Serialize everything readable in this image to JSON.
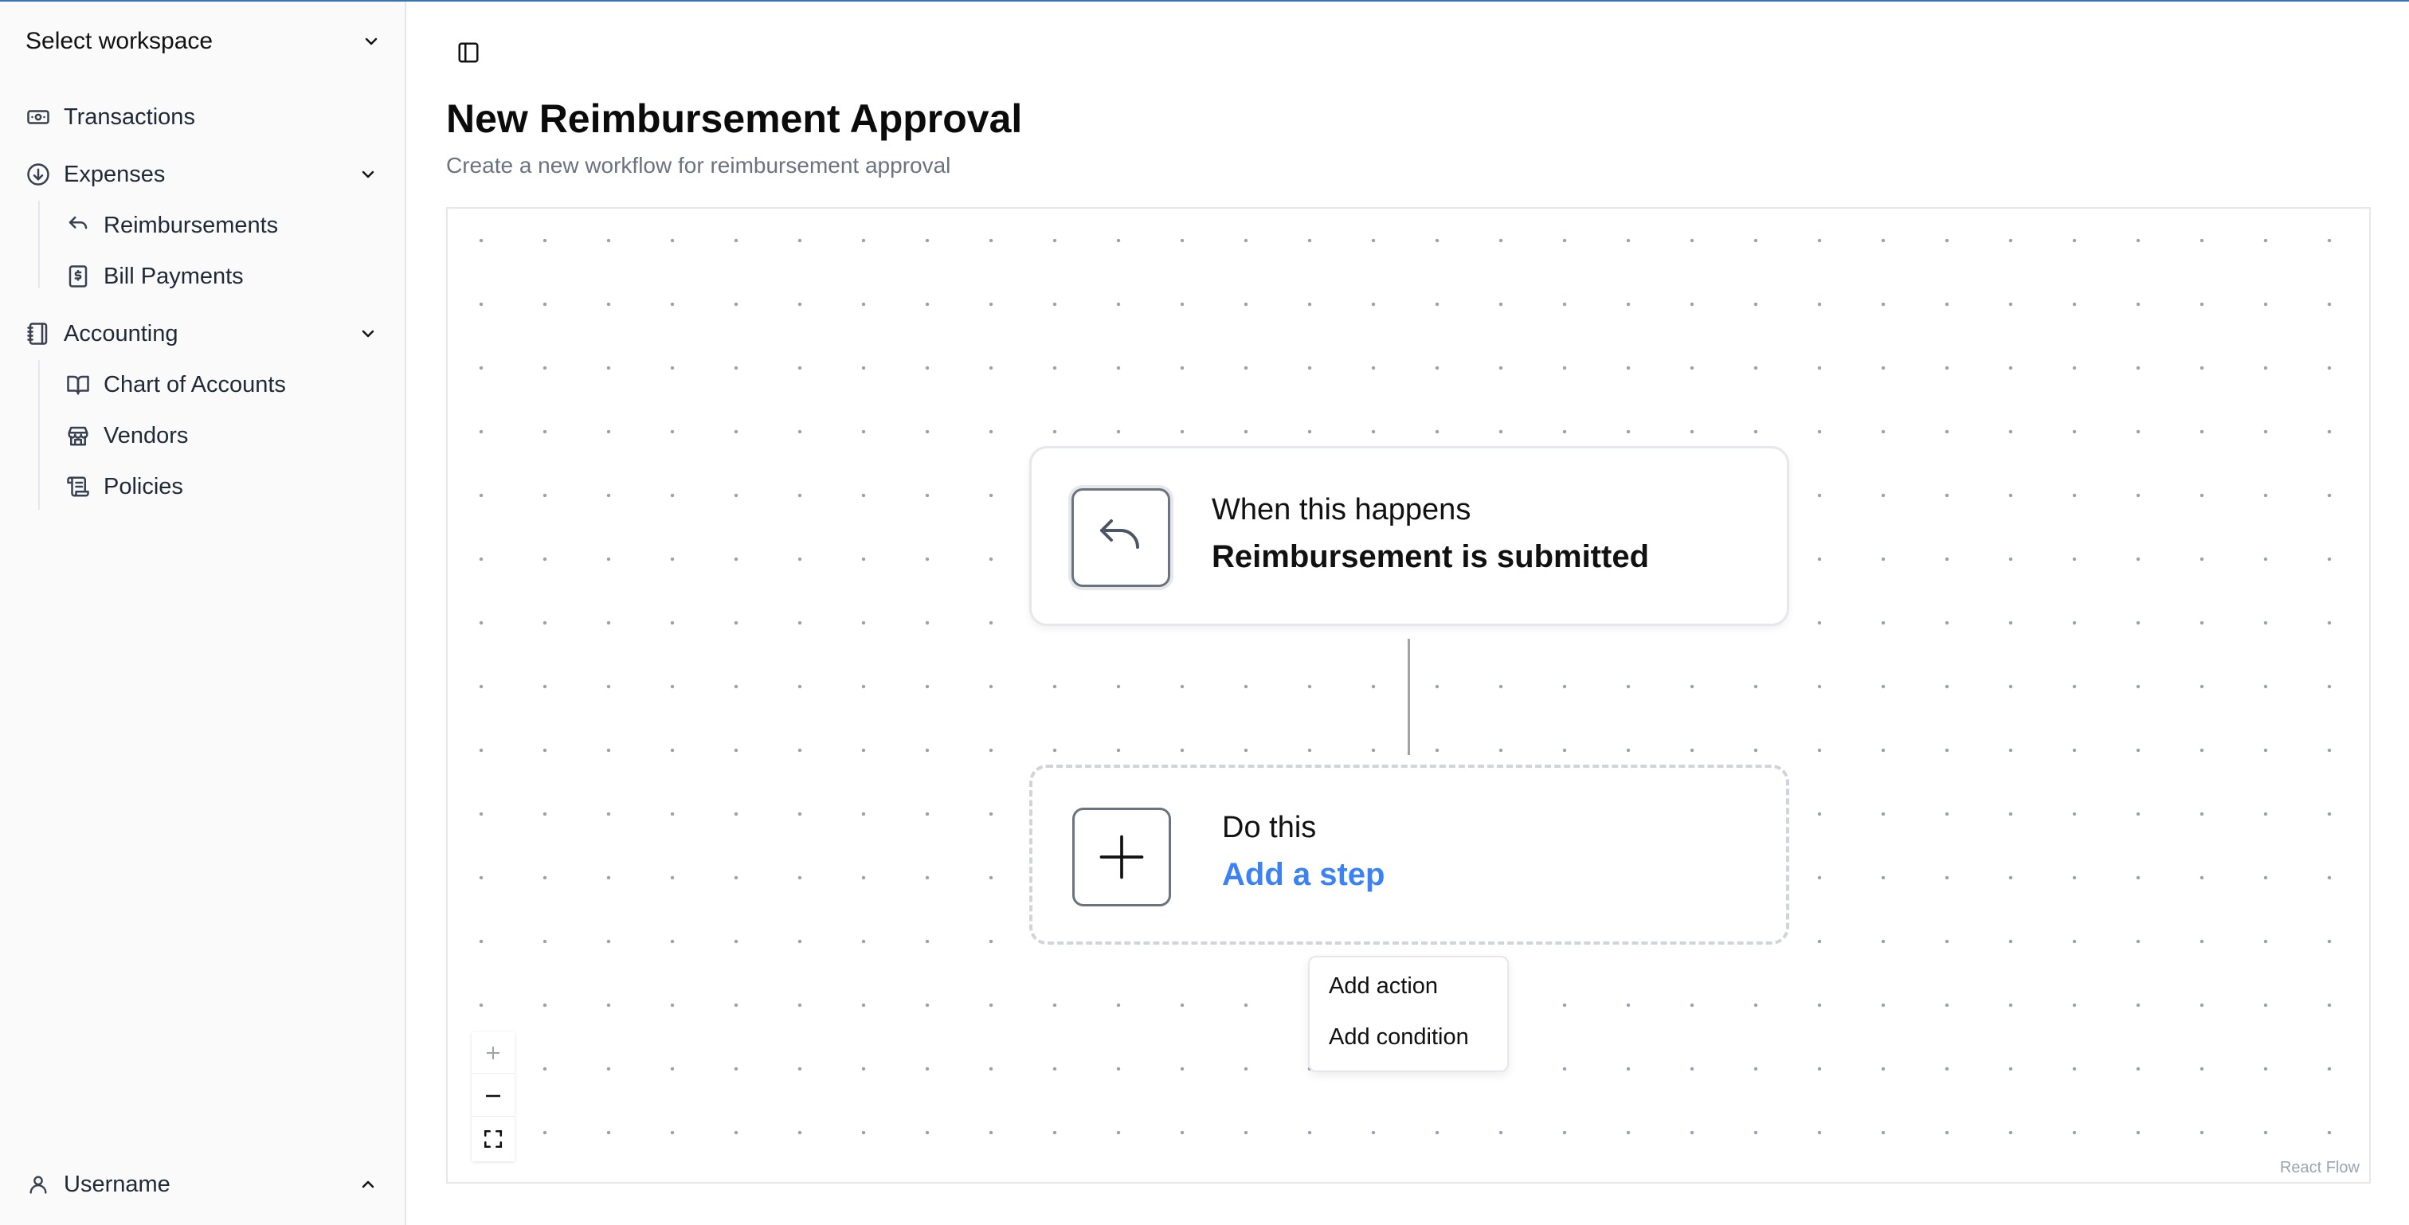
{
  "sidebar": {
    "workspace_label": "Select workspace",
    "items": [
      {
        "label": "Transactions",
        "icon": "banknote-icon"
      },
      {
        "label": "Expenses",
        "icon": "circle-arrow-down-icon",
        "children": [
          {
            "label": "Reimbursements",
            "icon": "undo-icon"
          },
          {
            "label": "Bill Payments",
            "icon": "receipt-dollar-icon"
          }
        ]
      },
      {
        "label": "Accounting",
        "icon": "notebook-icon",
        "children": [
          {
            "label": "Chart of Accounts",
            "icon": "book-open-icon"
          },
          {
            "label": "Vendors",
            "icon": "store-icon"
          },
          {
            "label": "Policies",
            "icon": "scroll-icon"
          }
        ]
      }
    ],
    "user_label": "Username"
  },
  "main": {
    "title": "New Reimbursement Approval",
    "subtitle": "Create a new workflow for reimbursement approval"
  },
  "flow": {
    "trigger": {
      "label": "When this happens",
      "value": "Reimbursement is submitted",
      "icon": "undo-icon"
    },
    "action": {
      "label": "Do this",
      "value": "Add a step",
      "icon": "plus-icon"
    },
    "menu": [
      "Add action",
      "Add condition"
    ],
    "attribution": "React Flow"
  },
  "colors": {
    "accent": "#3b82f6",
    "text": "#111827",
    "muted": "#6b7280",
    "border": "#e5e7eb"
  }
}
